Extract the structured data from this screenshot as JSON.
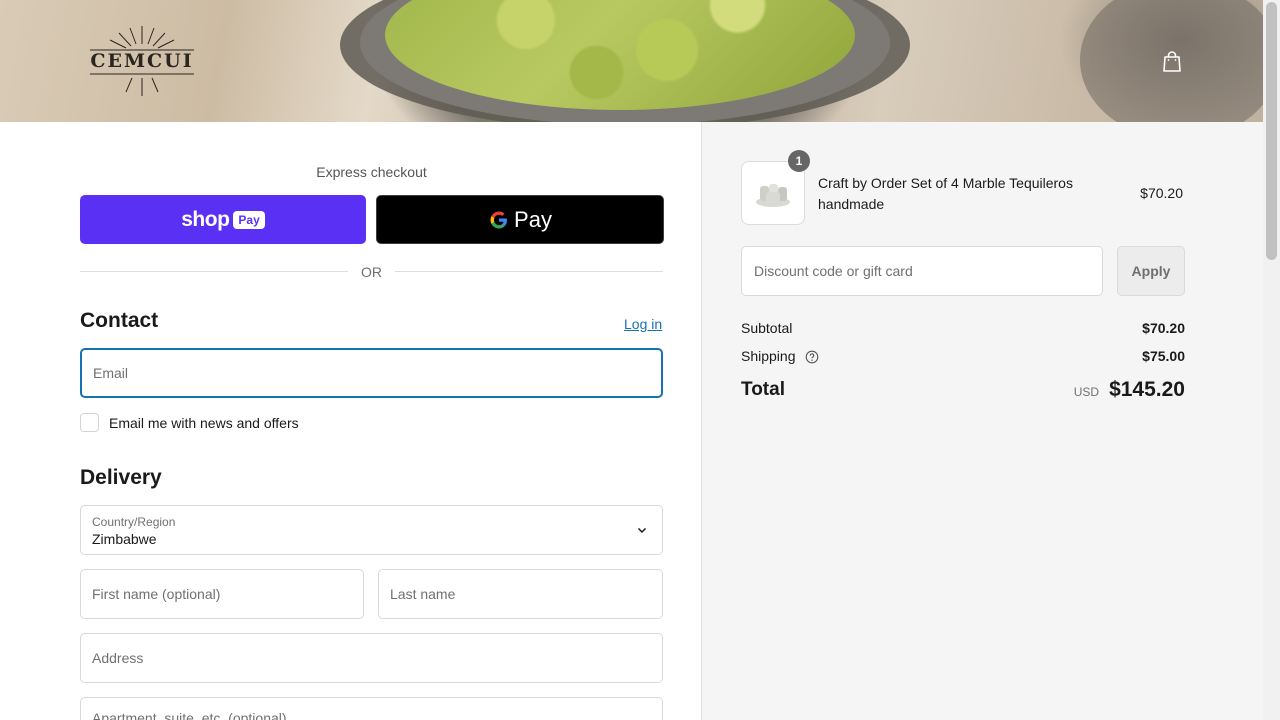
{
  "header": {
    "logo_text": "CEMCUI",
    "cart_icon": "shopping-bag-icon"
  },
  "express": {
    "label": "Express checkout",
    "shoppay_word": "shop",
    "shoppay_chip": "Pay",
    "gpay_text": "Pay",
    "or_text": "OR"
  },
  "contact": {
    "title": "Contact",
    "login_link": "Log in",
    "email_placeholder": "Email",
    "newsletter_label": "Email me with news and offers"
  },
  "delivery": {
    "title": "Delivery",
    "country_caption": "Country/Region",
    "country_value": "Zimbabwe",
    "first_name_placeholder": "First name (optional)",
    "last_name_placeholder": "Last name",
    "address_placeholder": "Address",
    "apartment_placeholder": "Apartment, suite, etc. (optional)"
  },
  "summary": {
    "item": {
      "quantity": "1",
      "name": "Craft by Order Set of 4 Marble Tequileros handmade",
      "price": "$70.20"
    },
    "discount_placeholder": "Discount code or gift card",
    "apply_label": "Apply",
    "subtotal_label": "Subtotal",
    "subtotal_value": "$70.20",
    "shipping_label": "Shipping",
    "shipping_value": "$75.00",
    "total_label": "Total",
    "currency": "USD",
    "total_value": "$145.20"
  },
  "colors": {
    "shop_pay": "#5a31f4",
    "link": "#1773b0",
    "summary_bg": "#f5f5f5"
  }
}
